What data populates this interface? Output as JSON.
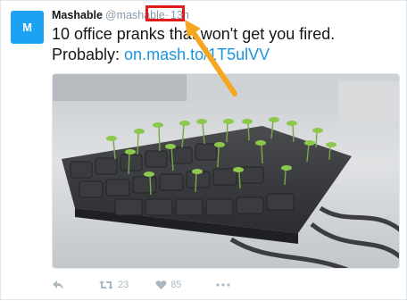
{
  "tweet": {
    "avatar_letter": "M",
    "display_name": "Mashable",
    "handle": "@mashable",
    "separator": "·",
    "timestamp": "13h",
    "text": "10 office pranks that won't get you fired. Probably: ",
    "link": "on.mash.to/1T5ulVV"
  },
  "media": {
    "description_icon": "keyboard-with-sprouts-photo"
  },
  "actions": {
    "reply_icon": "reply-icon",
    "retweet_icon": "retweet-icon",
    "retweet_count": "23",
    "like_icon": "heart-icon",
    "like_count": "85",
    "more_icon": "more-icon"
  },
  "colors": {
    "brand": "#1da1f2",
    "link": "#1b95e0",
    "highlight": "#e01b1b",
    "annotation_arrow": "#f5a623",
    "like": "#e81c4f"
  }
}
